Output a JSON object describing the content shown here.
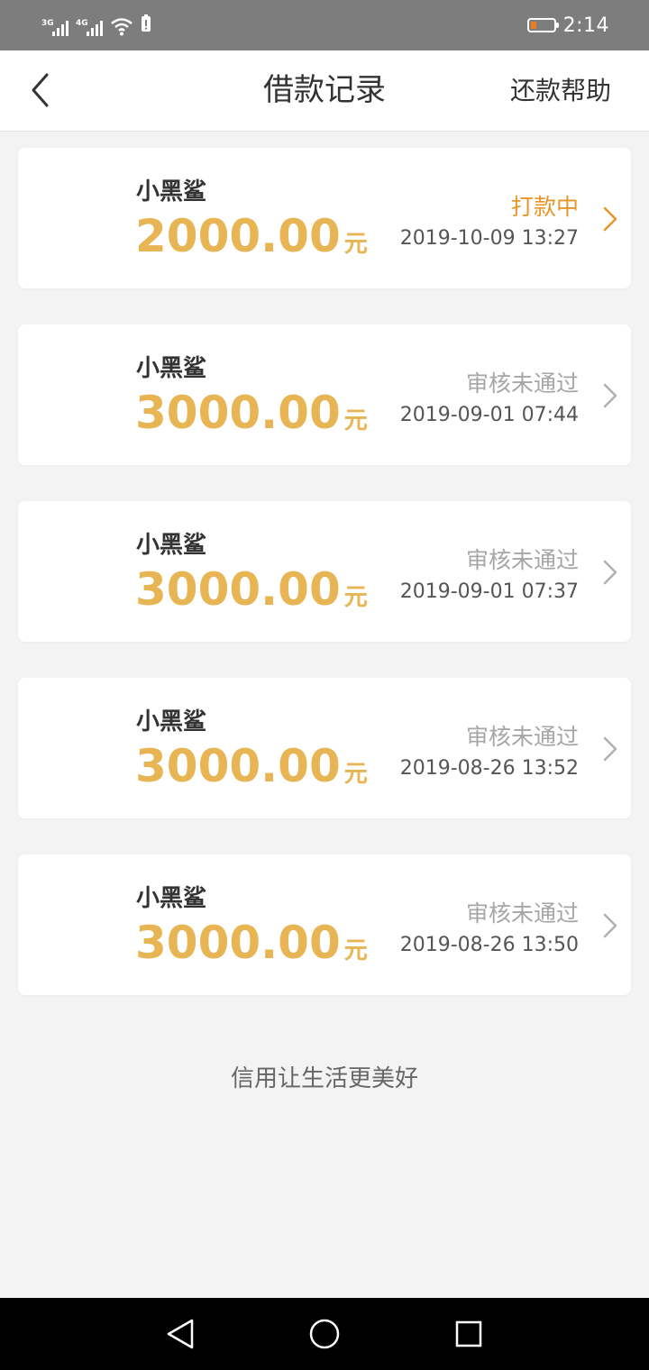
{
  "status_bar": {
    "signal_1_tag": "3G",
    "signal_2_tag": "4G",
    "time": "2:14",
    "battery_color": "#f07c1a"
  },
  "header": {
    "title": "借款记录",
    "right_link": "还款帮助",
    "back_icon": "chevron-left-icon"
  },
  "records": [
    {
      "name": "小黑鲨",
      "amount": "2000.00",
      "unit": "元",
      "status": "打款中",
      "status_type": "pending",
      "datetime": "2019-10-09 13:27"
    },
    {
      "name": "小黑鲨",
      "amount": "3000.00",
      "unit": "元",
      "status": "审核未通过",
      "status_type": "rejected",
      "datetime": "2019-09-01 07:44"
    },
    {
      "name": "小黑鲨",
      "amount": "3000.00",
      "unit": "元",
      "status": "审核未通过",
      "status_type": "rejected",
      "datetime": "2019-09-01 07:37"
    },
    {
      "name": "小黑鲨",
      "amount": "3000.00",
      "unit": "元",
      "status": "审核未通过",
      "status_type": "rejected",
      "datetime": "2019-08-26 13:52"
    },
    {
      "name": "小黑鲨",
      "amount": "3000.00",
      "unit": "元",
      "status": "审核未通过",
      "status_type": "rejected",
      "datetime": "2019-08-26 13:50"
    }
  ],
  "footer": {
    "slogan": "信用让生活更美好"
  },
  "colors": {
    "accent": "#e8b555",
    "pending": "#e8962a",
    "rejected": "#a6a6a6"
  },
  "nav": {
    "back_icon": "triangle-back-icon",
    "home_icon": "circle-home-icon",
    "recents_icon": "square-recents-icon"
  }
}
